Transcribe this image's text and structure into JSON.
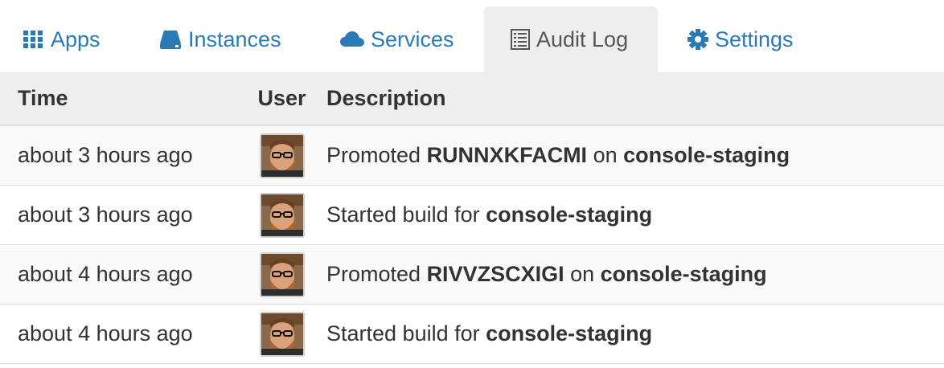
{
  "tabs": [
    {
      "label": "Apps",
      "icon": "grid-icon"
    },
    {
      "label": "Instances",
      "icon": "server-icon"
    },
    {
      "label": "Services",
      "icon": "cloud-icon"
    },
    {
      "label": "Audit Log",
      "icon": "list-icon"
    },
    {
      "label": "Settings",
      "icon": "gear-icon"
    }
  ],
  "active_tab": "Audit Log",
  "colors": {
    "link": "#2a7ab6",
    "active_tab_bg": "#eeeeee",
    "header_bg": "#eeeeee",
    "stripe": "#f9f9f9"
  },
  "table": {
    "headers": {
      "time": "Time",
      "user": "User",
      "description": "Description"
    },
    "rows": [
      {
        "time": "about 3 hours ago",
        "parts": [
          {
            "t": "Promoted "
          },
          {
            "t": "RUNNXKFACMI",
            "b": true
          },
          {
            "t": " on "
          },
          {
            "t": "console-staging",
            "b": true
          }
        ]
      },
      {
        "time": "about 3 hours ago",
        "parts": [
          {
            "t": "Started build for "
          },
          {
            "t": "console-staging",
            "b": true
          }
        ]
      },
      {
        "time": "about 4 hours ago",
        "parts": [
          {
            "t": "Promoted "
          },
          {
            "t": "RIVVZSCXIGI",
            "b": true
          },
          {
            "t": " on "
          },
          {
            "t": "console-staging",
            "b": true
          }
        ]
      },
      {
        "time": "about 4 hours ago",
        "parts": [
          {
            "t": "Started build for "
          },
          {
            "t": "console-staging",
            "b": true
          }
        ]
      }
    ]
  }
}
